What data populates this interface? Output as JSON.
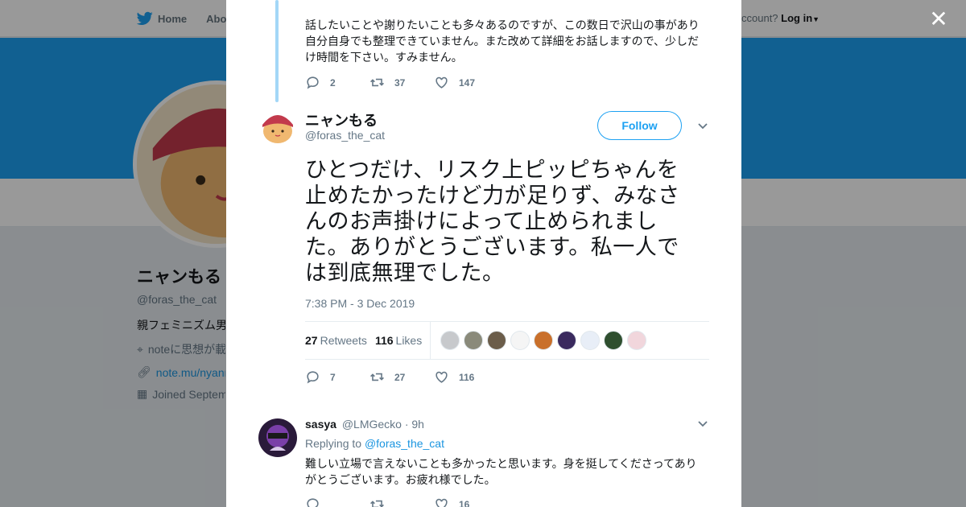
{
  "topbar": {
    "home_label": "Home",
    "about_label": "Abo",
    "account_prompt": "ccount?",
    "login_label": "Log in"
  },
  "background_profile": {
    "name": "ニャンもる",
    "handle": "@foras_the_cat",
    "bio": "親フェミニズム男",
    "location": "noteに思想が載",
    "link": "note.mu/nyanm",
    "joined": "Joined Septem"
  },
  "colors": {
    "accent": "#1da1f2",
    "thread_line": "#a3d7f7",
    "banner": "#1da1f2"
  },
  "previous_tweet": {
    "text": "話したいことや謝りたいことも多々あるのですが、この数日で沢山の事があり自分自身でも整理できていません。また改めて詳細をお話しますので、少しだけ時間を下さい。すみません。",
    "replies": "2",
    "retweets": "37",
    "likes": "147"
  },
  "main_tweet": {
    "name": "ニャンもる",
    "handle": "@foras_the_cat",
    "follow_label": "Follow",
    "text": "ひとつだけ、リスク上ピッピちゃんを止めたかったけど力が足りず、みなさんのお声掛けによって止められました。ありがとうございます。私一人では到底無理でした。",
    "timestamp": "7:38 PM - 3 Dec 2019",
    "retweets_count": "27",
    "retweets_label": "Retweets",
    "likes_count": "116",
    "likes_label": "Likes",
    "liker_avatars": [
      "#c7c9cc",
      "#8a8a7a",
      "#6b5d4a",
      "#f5f5f5",
      "#c9702b",
      "#3a2a5e",
      "#e8eef7",
      "#2f4f2f",
      "#f1d6dc"
    ],
    "action_replies": "7",
    "action_retweets": "27",
    "action_likes": "116"
  },
  "reply_tweet": {
    "name": "sasya",
    "handle": "@LMGecko",
    "time": "· 9h",
    "replying_prefix": "Replying to",
    "replying_to": "@foras_the_cat",
    "text": "難しい立場で言えないことも多かったと思います。身を挺してくださってありがとうございます。お疲れ様でした。",
    "likes": "16"
  }
}
